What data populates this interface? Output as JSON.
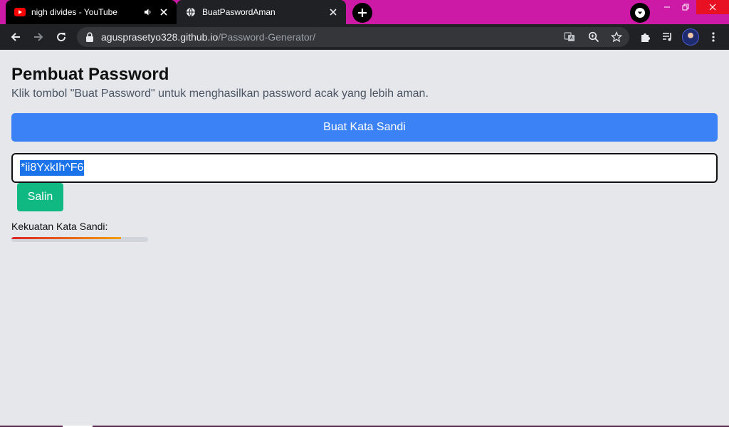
{
  "browser": {
    "tabs": [
      {
        "title": "nigh divides - YouTube",
        "favicon": "youtube-icon",
        "audio": "speaker-icon"
      },
      {
        "title": "BuatPaswordAman",
        "favicon": "globe-icon"
      }
    ],
    "url_host": "agusprasetyo328.github.io",
    "url_path": "/Password-Generator/",
    "colors": {
      "tabstrip": "#cc1aa6",
      "toolbar": "#202124",
      "close_hover": "#e81123"
    }
  },
  "page": {
    "title": "Pembuat Password",
    "subtitle": "Klik tombol \"Buat Password\" untuk menghasilkan password acak yang lebih aman.",
    "generate_label": "Buat Kata Sandi",
    "password_value": "*ii8YxkIh^F6",
    "copy_label": "Salin",
    "strength_label": "Kekuatan Kata Sandi:",
    "strength_fraction": 0.8,
    "colors": {
      "primary": "#3b82f6",
      "copy": "#10b981",
      "strength_weak": "#dc2626",
      "strength_mid": "#f59e0b"
    }
  }
}
